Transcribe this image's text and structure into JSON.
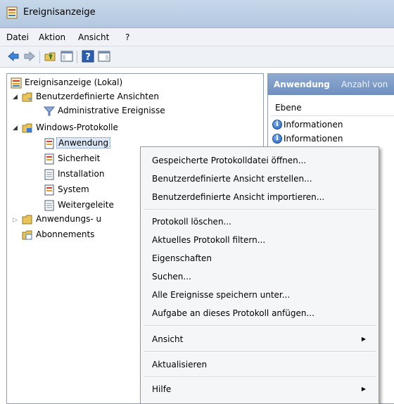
{
  "window": {
    "title": "Ereignisanzeige"
  },
  "menubar": {
    "items": [
      "Datei",
      "Aktion",
      "Ansicht",
      "?"
    ]
  },
  "toolbar": {
    "buttons": [
      "back-arrow-icon",
      "forward-arrow-icon",
      "up-folder-icon",
      "show-hide-tree-icon",
      "help-icon",
      "show-hide-action-pane-icon"
    ]
  },
  "tree": {
    "root": "Ereignisanzeige (Lokal)",
    "custom_views": "Benutzerdefinierte Ansichten",
    "admin_events": "Administrative Ereignisse",
    "windows_logs": "Windows-Protokolle",
    "application": "Anwendung",
    "security": "Sicherheit",
    "setup": "Installation",
    "system": "System",
    "forwarded": "Weitergeleite",
    "app_service_logs": "Anwendungs- u",
    "subscriptions": "Abonnements"
  },
  "rightpane": {
    "header_title": "Anwendung",
    "header_count": "Anzahl von",
    "column_header": "Ebene",
    "rows": [
      "Informationen",
      "Informationen"
    ]
  },
  "context_menu": {
    "items": [
      "Gespeicherte Protokolldatei öffnen...",
      "Benutzerdefinierte Ansicht erstellen...",
      "Benutzerdefinierte Ansicht importieren...",
      "Protokoll löschen...",
      "Aktuelles Protokoll filtern...",
      "Eigenschaften",
      "Suchen...",
      "Alle Ereignisse speichern unter...",
      "Aufgabe an dieses Protokoll anfügen...",
      "Ansicht",
      "Aktualisieren",
      "Hilfe"
    ]
  },
  "colors": {
    "titlebar": "#b9cde3",
    "selection": "#dce8f7",
    "pane_header": "#7f9ccb"
  }
}
